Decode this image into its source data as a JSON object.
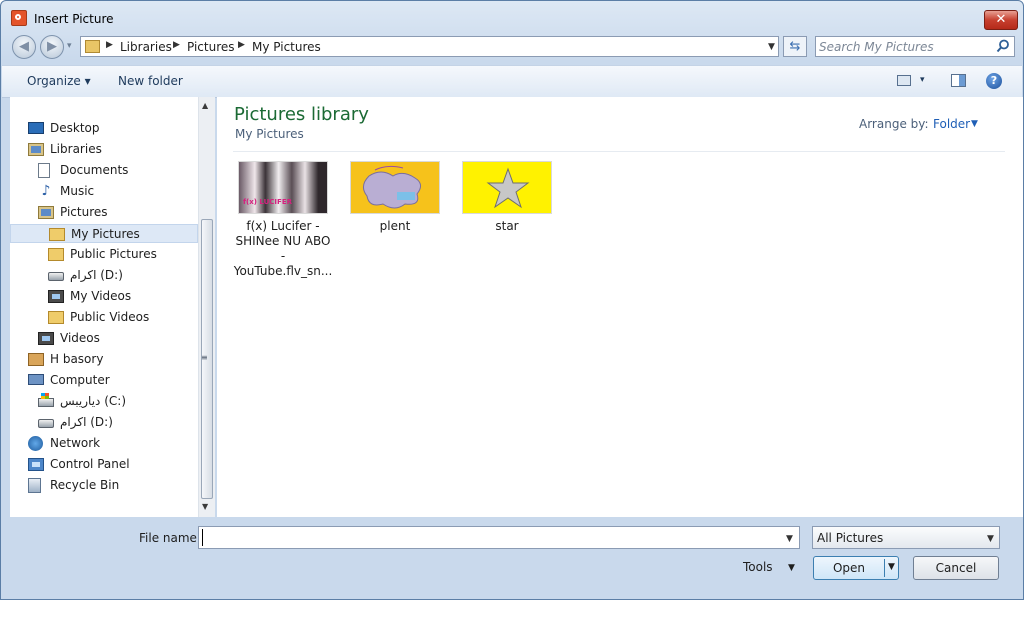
{
  "window": {
    "title": "Insert Picture",
    "close_label": "✕"
  },
  "nav": {
    "back_label": "◀",
    "forward_label": "▶",
    "history_label": "▾",
    "refresh_label": "⇆",
    "breadcrumbs": [
      "Libraries",
      "Pictures",
      "My Pictures"
    ]
  },
  "search": {
    "placeholder": "Search My Pictures"
  },
  "toolbar": {
    "organize_label": "Organize ▾",
    "new_folder_label": "New folder",
    "view_drop": "▾",
    "help_label": "?"
  },
  "tree": {
    "items": [
      {
        "label": "Desktop",
        "icon": "desktop-icon"
      },
      {
        "label": "Libraries",
        "icon": "library-icon"
      },
      {
        "label": "Documents",
        "icon": "document-icon"
      },
      {
        "label": "Music",
        "icon": "music-icon"
      },
      {
        "label": "Pictures",
        "icon": "pictures-icon"
      },
      {
        "label": "My Pictures",
        "icon": "folder-icon",
        "selected": true
      },
      {
        "label": "Public Pictures",
        "icon": "folder-icon"
      },
      {
        "label": "اكرام (D:)",
        "icon": "drive-icon"
      },
      {
        "label": "My Videos",
        "icon": "video-folder-icon"
      },
      {
        "label": "Public Videos",
        "icon": "folder-icon"
      },
      {
        "label": "Videos",
        "icon": "videos-icon"
      },
      {
        "label": "H basory",
        "icon": "user-folder-icon"
      },
      {
        "label": "Computer",
        "icon": "computer-icon"
      },
      {
        "label": "دياريبس (C:)",
        "icon": "system-drive-icon"
      },
      {
        "label": "اكرام (D:)",
        "icon": "drive-icon"
      },
      {
        "label": "Network",
        "icon": "network-icon"
      },
      {
        "label": "Control Panel",
        "icon": "control-panel-icon"
      },
      {
        "label": "Recycle Bin",
        "icon": "recycle-bin-icon"
      }
    ]
  },
  "content": {
    "title": "Pictures library",
    "subtitle": "My Pictures",
    "arrange_label": "Arrange by:",
    "arrange_value": "Folder",
    "files": [
      {
        "name_lines": [
          "f(x) Lucifer -",
          "SHINee NU ABO",
          "-",
          "YouTube.flv_sn..."
        ],
        "thumb_caption": "f(x) LUCIFER"
      },
      {
        "name_lines": [
          "plent"
        ],
        "thumb_caption": ""
      },
      {
        "name_lines": [
          "star"
        ],
        "thumb_caption": ""
      }
    ]
  },
  "bottom": {
    "filename_label": "File name:",
    "filename_value": "",
    "filetype_value": "All Pictures",
    "tools_label": "Tools",
    "open_label": "Open",
    "cancel_label": "Cancel"
  },
  "colors": {
    "title_green": "#1b6a34",
    "link_blue": "#1f5fb6",
    "selection": "#dde8f6"
  }
}
